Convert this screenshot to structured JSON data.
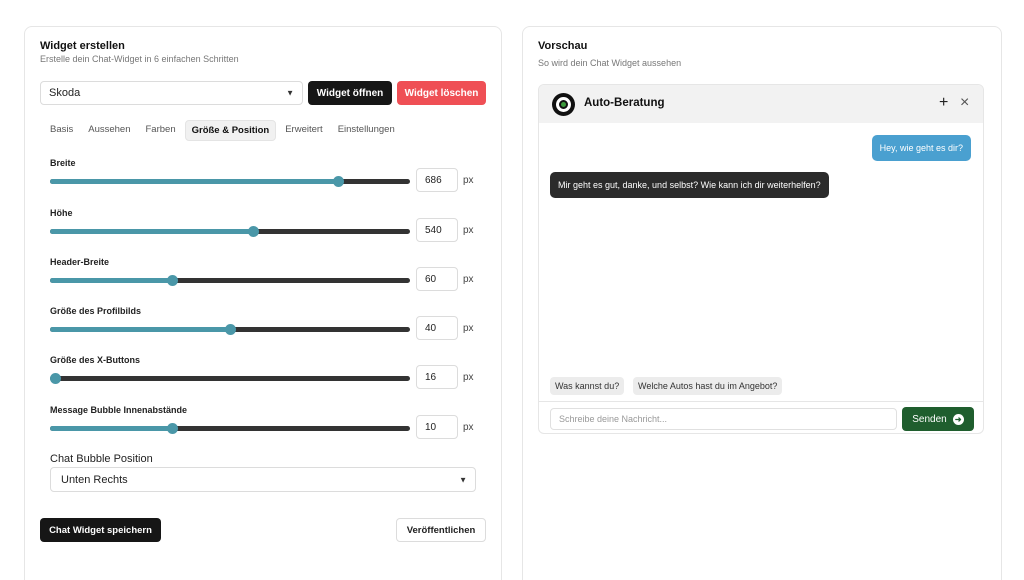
{
  "builder": {
    "title": "Widget erstellen",
    "subtitle": "Erstelle dein Chat-Widget in 6 einfachen Schritten",
    "selected_widget": "Skoda",
    "open_label": "Widget öffnen",
    "delete_label": "Widget löschen",
    "tabs": [
      {
        "label": "Basis"
      },
      {
        "label": "Aussehen"
      },
      {
        "label": "Farben"
      },
      {
        "label": "Größe & Position",
        "active": true
      },
      {
        "label": "Erweitert"
      },
      {
        "label": "Einstellungen"
      }
    ],
    "sliders": [
      {
        "label": "Breite",
        "value": "686",
        "fraction": 0.8,
        "unit": "px"
      },
      {
        "label": "Höhe",
        "value": "540",
        "fraction": 0.565,
        "unit": "px"
      },
      {
        "label": "Header-Breite",
        "value": "60",
        "fraction": 0.34,
        "unit": "px"
      },
      {
        "label": "Größe des Profilbilds",
        "value": "40",
        "fraction": 0.5,
        "unit": "px"
      },
      {
        "label": "Größe des X-Buttons",
        "value": "16",
        "fraction": 0.0,
        "unit": "px"
      },
      {
        "label": "Message Bubble Innenabstände",
        "value": "10",
        "fraction": 0.34,
        "unit": "px"
      }
    ],
    "position_label": "Chat Bubble Position",
    "position_value": "Unten Rechts",
    "save_label": "Chat Widget speichern",
    "publish_label": "Veröffentlichen"
  },
  "preview": {
    "title": "Vorschau",
    "subtitle": "So wird dein Chat Widget aussehen",
    "bot_name": "Auto-Beratung",
    "plus_icon": "+",
    "close_icon": "×",
    "user_message": "Hey, wie geht es dir?",
    "bot_message": "Mir geht es gut, danke, und selbst? Wie kann ich dir weiterhelfen?",
    "suggestions": [
      "Was kannst du?",
      "Welche Autos hast du im Angebot?"
    ],
    "input_placeholder": "Schreibe deine Nachricht...",
    "send_label": "Senden",
    "colors": {
      "accent": "#4a97a8",
      "user_bubble": "#4aa0d0",
      "bot_bubble": "#2b2b2b",
      "send_button": "#1f5e2e",
      "delete_button": "#ef4f55"
    }
  }
}
